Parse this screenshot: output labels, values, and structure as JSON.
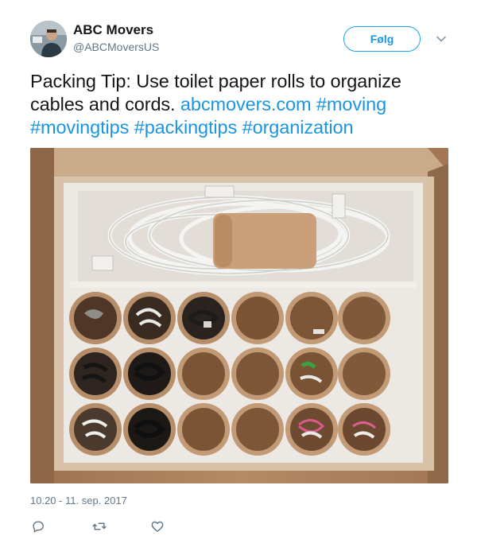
{
  "author": {
    "name": "ABC Movers",
    "handle": "@ABCMoversUS",
    "avatar_icon": "profile-photo"
  },
  "follow_button": {
    "label": "Følg"
  },
  "tweet": {
    "text_plain": "Packing Tip: Use toilet paper rolls to organize cables and cords. ",
    "link": "abcmovers.com",
    "hashtags": [
      "#moving",
      "#movingtips",
      "#packingtips",
      "#organization"
    ],
    "timestamp": "10.20 - 11. sep. 2017"
  },
  "actions": {
    "reply_icon": "reply-icon",
    "retweet_icon": "retweet-icon",
    "like_icon": "heart-icon"
  },
  "colors": {
    "link": "#1b95e0",
    "text": "#14171a",
    "muted": "#657786"
  }
}
